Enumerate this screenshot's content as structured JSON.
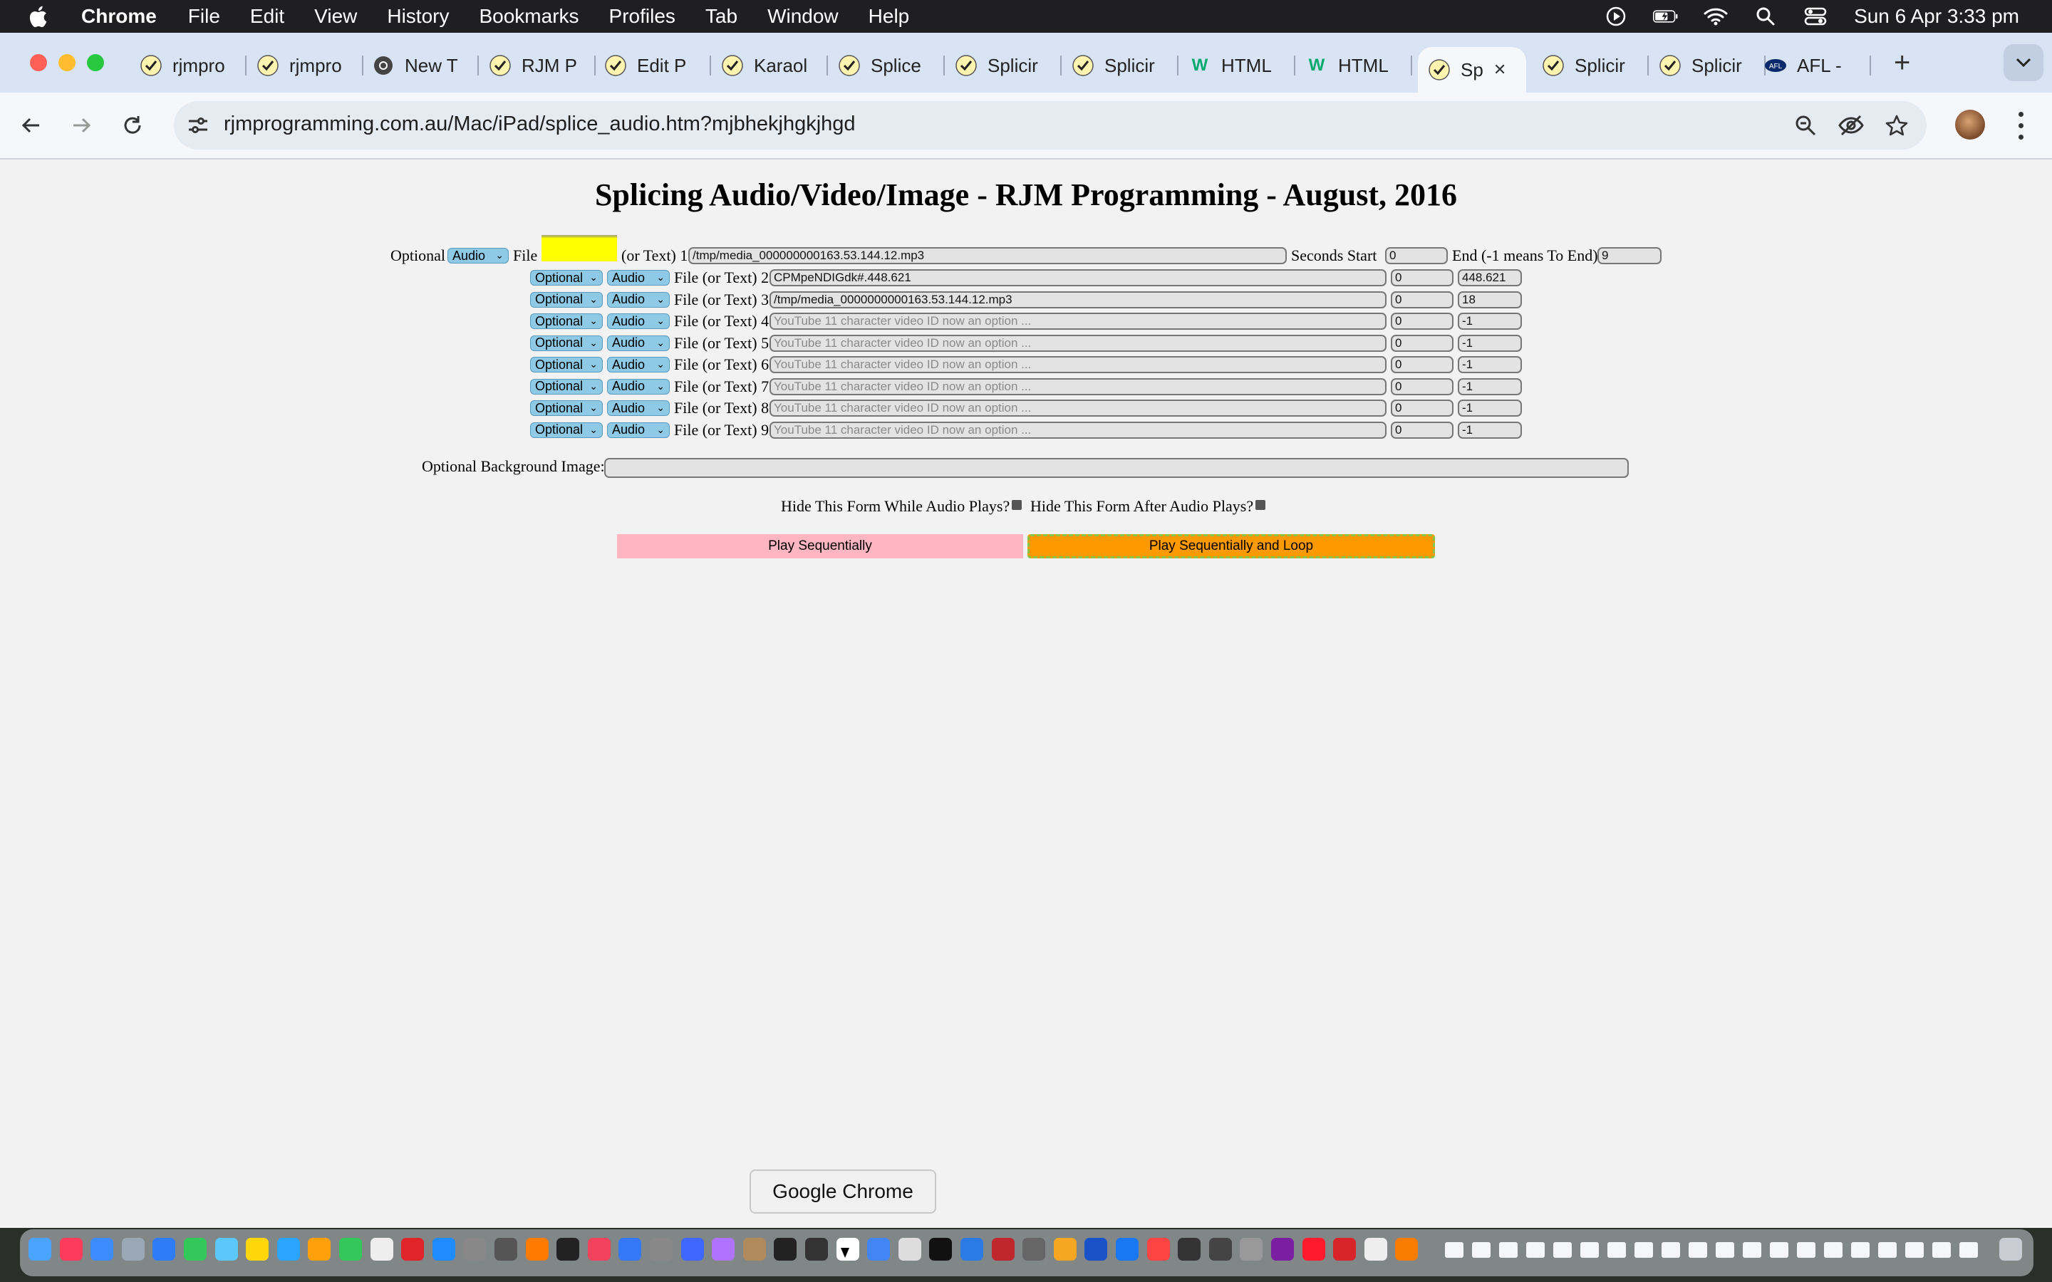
{
  "menubar": {
    "app_name": "Chrome",
    "items": [
      "File",
      "Edit",
      "View",
      "History",
      "Bookmarks",
      "Profiles",
      "Tab",
      "Window",
      "Help"
    ],
    "clock": "Sun 6 Apr  3:33 pm"
  },
  "tabs": [
    {
      "title": "rjmpro",
      "icon": "rjm-favicon"
    },
    {
      "title": "rjmpro",
      "icon": "rjm-favicon"
    },
    {
      "title": "New T",
      "icon": "chrome-icon"
    },
    {
      "title": "RJM P",
      "icon": "rjm-favicon"
    },
    {
      "title": "Edit P",
      "icon": "rjm-favicon"
    },
    {
      "title": "Karaol",
      "icon": "rjm-favicon"
    },
    {
      "title": "Splice",
      "icon": "rjm-favicon"
    },
    {
      "title": "Splicir",
      "icon": "rjm-favicon"
    },
    {
      "title": "Splicir",
      "icon": "rjm-favicon"
    },
    {
      "title": "HTML",
      "icon": "w3schools-icon"
    },
    {
      "title": "HTML",
      "icon": "w3schools-icon"
    },
    {
      "title": "Sp",
      "icon": "rjm-favicon",
      "active": true
    },
    {
      "title": "Splicir",
      "icon": "rjm-favicon"
    },
    {
      "title": "Splicir",
      "icon": "rjm-favicon"
    },
    {
      "title": "AFL -",
      "icon": "afl-icon"
    }
  ],
  "address_bar": {
    "url": "rjmprogramming.com.au/Mac/iPad/splice_audio.htm?mjbhekjhgkjhgd"
  },
  "page": {
    "title": "Splicing Audio/Video/Image - RJM Programming - August, 2016",
    "row1": {
      "optional_label": "Optional",
      "type_select": "Audio",
      "file_label": "File",
      "or_text_label": "(or Text) 1",
      "file_value": "/tmp/media_000000000163.53.144.12.mp3",
      "seconds_start_label": "Seconds Start",
      "start_value": "0",
      "end_label": "End (-1 means To End)",
      "end_value": "9"
    },
    "rows": [
      {
        "optional": "Optional",
        "type": "Audio",
        "label": "File (or Text) 2",
        "value": "CPMpeNDIGdk#.448.621",
        "placeholder": "",
        "start": "0",
        "end": "448.621"
      },
      {
        "optional": "Optional",
        "type": "Audio",
        "label": "File (or Text) 3",
        "value": "/tmp/media_0000000000163.53.144.12.mp3",
        "placeholder": "",
        "start": "0",
        "end": "18"
      },
      {
        "optional": "Optional",
        "type": "Audio",
        "label": "File (or Text) 4",
        "value": "",
        "placeholder": "YouTube 11 character video ID now an option ...",
        "start": "0",
        "end": "-1"
      },
      {
        "optional": "Optional",
        "type": "Audio",
        "label": "File (or Text) 5",
        "value": "",
        "placeholder": "YouTube 11 character video ID now an option ...",
        "start": "0",
        "end": "-1"
      },
      {
        "optional": "Optional",
        "type": "Audio",
        "label": "File (or Text) 6",
        "value": "",
        "placeholder": "YouTube 11 character video ID now an option ...",
        "start": "0",
        "end": "-1"
      },
      {
        "optional": "Optional",
        "type": "Audio",
        "label": "File (or Text) 7",
        "value": "",
        "placeholder": "YouTube 11 character video ID now an option ...",
        "start": "0",
        "end": "-1"
      },
      {
        "optional": "Optional",
        "type": "Audio",
        "label": "File (or Text) 8",
        "value": "",
        "placeholder": "YouTube 11 character video ID now an option ...",
        "start": "0",
        "end": "-1"
      },
      {
        "optional": "Optional",
        "type": "Audio",
        "label": "File (or Text) 9",
        "value": "",
        "placeholder": "YouTube 11 character video ID now an option ...",
        "start": "0",
        "end": "-1"
      }
    ],
    "background_image_label": "Optional Background Image:",
    "hide_while_label": "Hide This Form While Audio Plays?",
    "hide_after_label": "Hide This Form After Audio Plays?",
    "play_sequential": "Play Sequentially",
    "play_loop": "Play Sequentially and Loop"
  },
  "tooltip": "Google Chrome",
  "colors": {
    "file_yellow": "#ffff00",
    "select_blue": "#8ecae6",
    "button_pink": "#ffb6c1",
    "button_orange": "#ff9900"
  }
}
